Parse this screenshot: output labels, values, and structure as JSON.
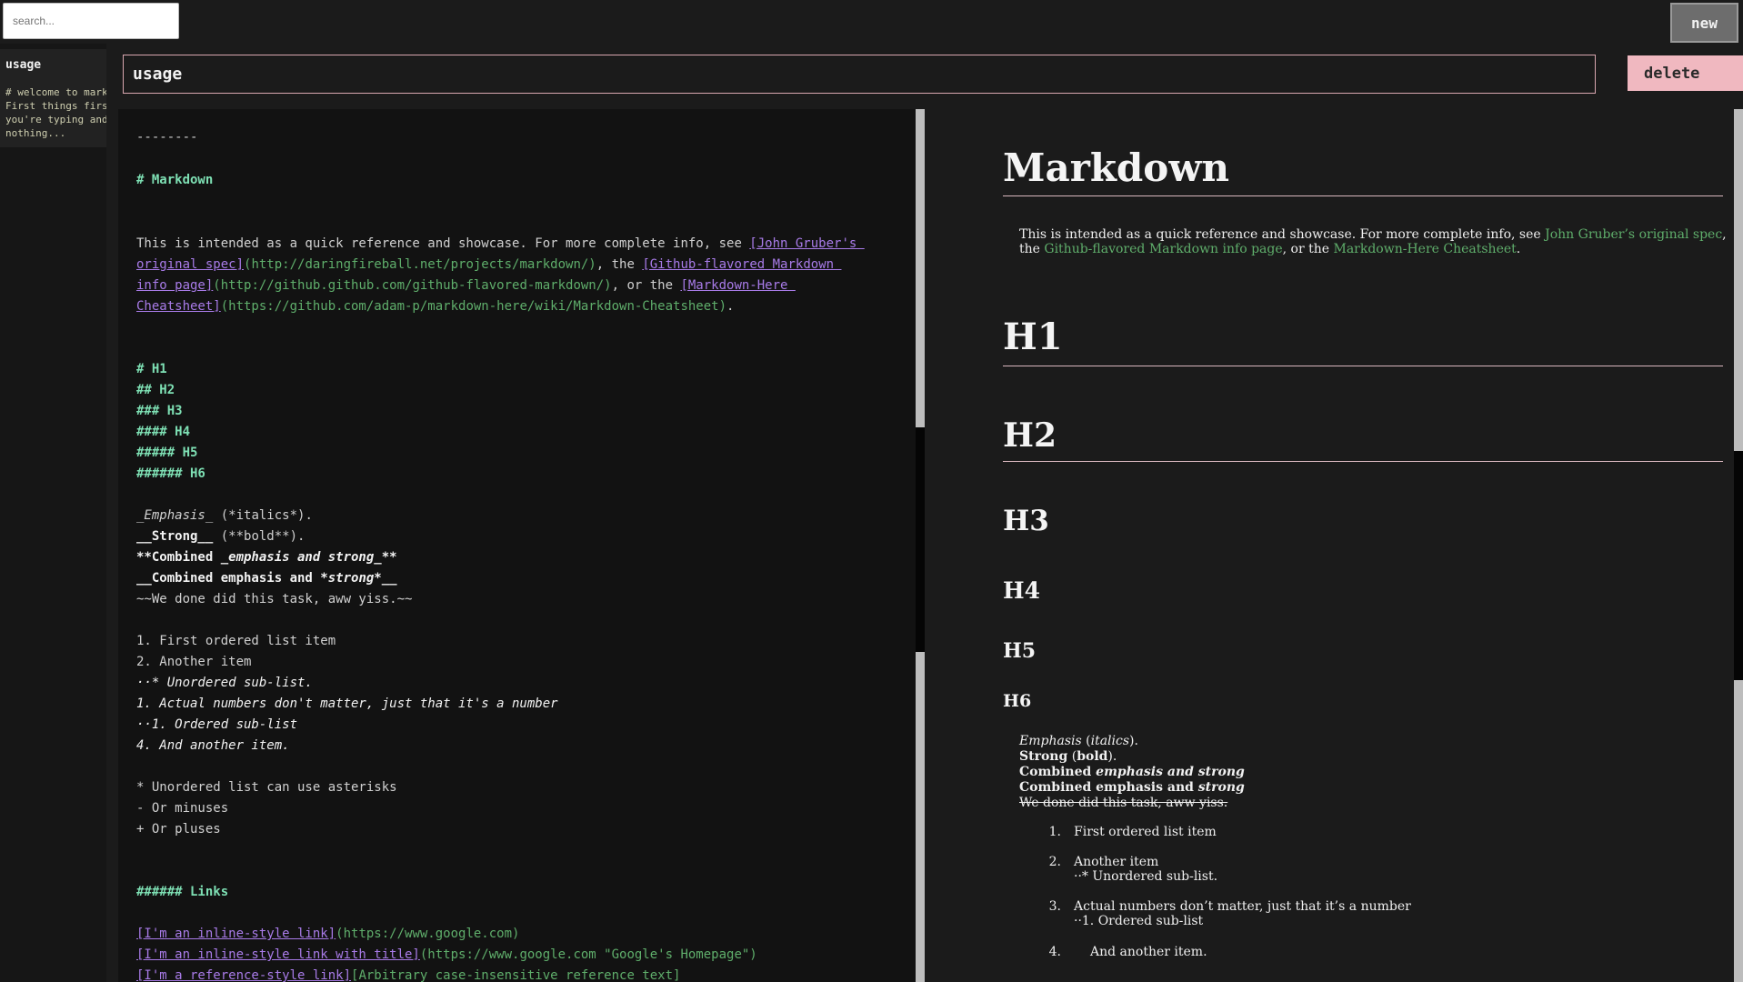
{
  "search": {
    "placeholder": "search..."
  },
  "toolbar": {
    "new_label": "new",
    "delete_label": "delete"
  },
  "sidebar": {
    "items": [
      {
        "title": "usage",
        "preview": "# welcome to markdown\nFirst things first\nyou're typing and\nnothing..."
      }
    ]
  },
  "note": {
    "title": "usage"
  },
  "editor": {
    "rule": "--------",
    "h_markdown": "# Markdown",
    "intro": {
      "t1": "This is intended as a quick reference and showcase. For more complete info, see ",
      "l1a": "[John Gruber's ",
      "l1b": "original spec]",
      "u1": "(http://daringfireball.net/projects/markdown/)",
      "t2": ", the ",
      "l2a": "[Github-flavored Markdown ",
      "l2b": "info page]",
      "u2": "(http://github.github.com/github-flavored-markdown/)",
      "t3": ", or the ",
      "l3a": "[Markdown-Here ",
      "l3b": "Cheatsheet]",
      "u3": "(https://github.com/adam-p/markdown-here/wiki/Markdown-Cheatsheet)",
      "t4": "."
    },
    "headings": [
      "# H1",
      "## H2",
      "### H3",
      "#### H4",
      "##### H5",
      "###### H6"
    ],
    "emphasis": {
      "e1a": "_Emphasis_",
      "e1b": " (*italics*).",
      "e2a": "__Strong__",
      "e2b": " (**bold**).",
      "e3a": "**Combined ",
      "e3b": "_emphasis and strong_",
      "e3c": "**",
      "e4a": "__Combined emphasis and ",
      "e4b": "*strong*",
      "e4c": "__",
      "e5": "~~We done did this task, aww yiss.~~"
    },
    "lists": [
      "1. First ordered list item",
      "2. Another item",
      "··* Unordered sub-list.",
      "1. Actual numbers don't matter, just that it's a number",
      "··1. Ordered sub-list",
      "4. And another item."
    ],
    "bullets": [
      "* Unordered list can use asterisks",
      "- Or minuses",
      "+ Or pluses"
    ],
    "h_links": "###### Links",
    "links": [
      {
        "label": "[I'm an inline-style link]",
        "url": "(https://www.google.com)"
      },
      {
        "label": "[I'm an inline-style link with title]",
        "url": "(https://www.google.com \"Google's Homepage\")"
      },
      {
        "label": "[I'm a reference-style link]",
        "url": "[Arbitrary case-insensitive reference text]"
      }
    ]
  },
  "preview": {
    "h1_markdown": "Markdown",
    "intro": {
      "t1": "This is intended as a quick reference and showcase. For more complete info, see ",
      "l1": "John Gruber’s original spec",
      "t2": ", the ",
      "l2": "Github-flavored Markdown info page",
      "t3": ", or the ",
      "l3": "Markdown-Here Cheatsheet",
      "t4": "."
    },
    "headings": [
      "H1",
      "H2",
      "H3",
      "H4",
      "H5",
      "H6"
    ],
    "emphasis": {
      "e1a": "Emphasis",
      "e1b": " (",
      "e1c": "italics",
      "e1d": ").",
      "e2a": "Strong",
      "e2b": " (",
      "e2c": "bold",
      "e2d": ").",
      "e3a": "Combined ",
      "e3b": "emphasis and strong",
      "e4a": "Combined emphasis and ",
      "e4b": "strong",
      "e5": "We done did this task, aww yiss."
    },
    "list": [
      {
        "num": "1.",
        "text": "First ordered list item"
      },
      {
        "num": "2.",
        "text": "Another item",
        "sub": "··* Unordered sub-list."
      },
      {
        "num": "3.",
        "text": "Actual numbers don’t matter, just that it’s a number",
        "sub": "··1. Ordered sub-list"
      },
      {
        "num": "4.",
        "text": "And another item."
      }
    ]
  }
}
